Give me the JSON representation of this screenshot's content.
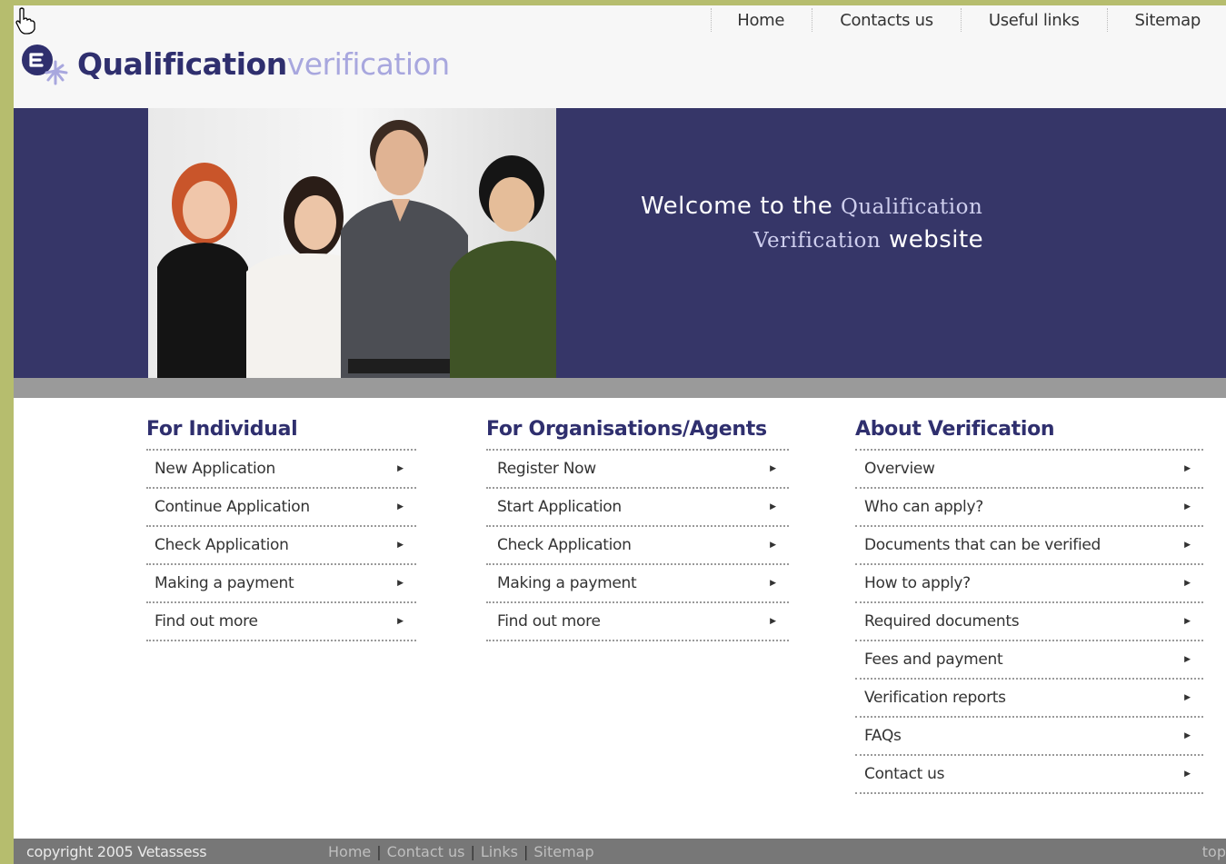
{
  "brand": {
    "name_bold": "Qualification",
    "name_light": "verification"
  },
  "topnav": [
    "Home",
    "Contacts us",
    "Useful links",
    "Sitemap"
  ],
  "banner": {
    "welcome_pre": "Welcome to the",
    "welcome_hl1": "Qualification",
    "welcome_hl2": "Verification",
    "welcome_post": "website"
  },
  "columns": {
    "individual": {
      "title": "For Individual",
      "items": [
        "New Application",
        "Continue Application",
        "Check Application",
        "Making a payment",
        "Find out more"
      ]
    },
    "organisations": {
      "title": "For Organisations/Agents",
      "items": [
        "Register Now",
        "Start Application",
        "Check Application",
        "Making a payment",
        "Find out more"
      ]
    },
    "about": {
      "title": "About Verification",
      "items": [
        "Overview",
        "Who can apply?",
        "Documents that can be verified",
        "How to apply?",
        "Required documents",
        "Fees and payment",
        "Verification reports",
        "FAQs",
        "Contact us"
      ]
    }
  },
  "footer": {
    "copyright": "copyright 2005 Vetassess",
    "links": [
      "Home",
      "Contact us",
      "Links",
      "Sitemap"
    ],
    "top": "top"
  },
  "colors": {
    "navy": "#363668",
    "brand_dark": "#2f2f6e",
    "brand_light": "#a8a7de",
    "frame": "#b6bd6e"
  }
}
